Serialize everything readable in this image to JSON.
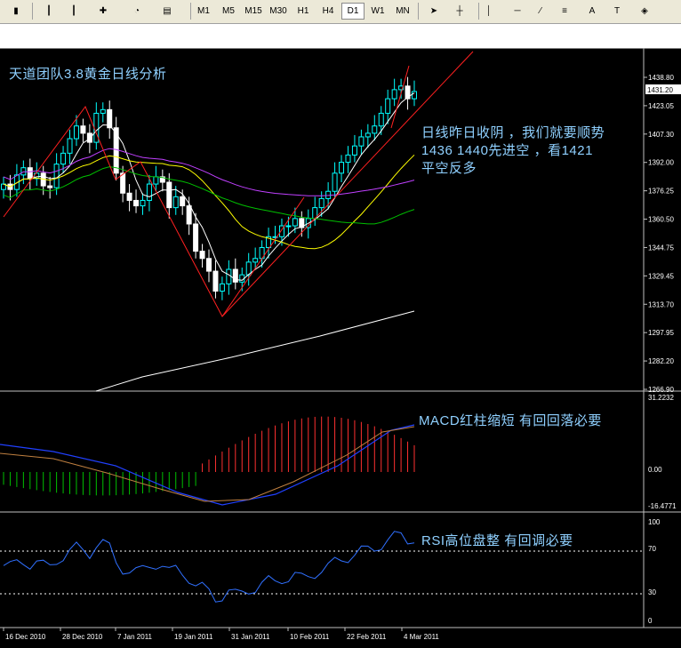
{
  "toolbar": {
    "timeframes": [
      "M1",
      "M5",
      "M15",
      "M30",
      "H1",
      "H4",
      "D1",
      "W1",
      "MN"
    ],
    "active_timeframe": "D1",
    "text_tool_label": "A",
    "text_label_tool_label": "T"
  },
  "chart": {
    "title": "天道团队3.8黄金日线分析",
    "note_lines": [
      "日线昨日收阴 ，我们就要顺势",
      "1436  1440先进空 ，看1421",
      "平空反多"
    ],
    "macd_note": "MACD红柱缩短 有回回落必要",
    "rsi_note": "RSI高位盘整 有回调必要",
    "price_scale": [
      "1438.80",
      "1423.05",
      "1407.30",
      "1392.00",
      "1376.25",
      "1360.50",
      "1344.75",
      "1329.45",
      "1313.70",
      "1297.95",
      "1282.20",
      "1266.90"
    ],
    "current_price": "1431.20",
    "macd_scale": [
      "31.2232",
      "0.00",
      "-16.4771"
    ],
    "rsi_scale": [
      "100",
      "70",
      "30",
      "0"
    ],
    "date_labels": [
      "16 Dec 2010",
      "28 Dec 2010",
      "7 Jan 2011",
      "19 Jan 2011",
      "31 Jan 2011",
      "10 Feb 2011",
      "22 Feb 2011",
      "4 Mar 2011"
    ],
    "colors": {
      "bull": "#00ff00",
      "bear": "#ffffff",
      "candle_up": "#00ffff",
      "candle_down": "#ffffff",
      "macd_pos": "#ff3030",
      "macd_neg": "#00c000",
      "trend": "#ff2020",
      "ma_short": "#ffffff",
      "ma_mid": "#ffff00",
      "ma_long": "#00c000",
      "ma_purple": "#c040ff",
      "text": "#8fd0ff",
      "rsi": "#3070ff"
    }
  },
  "chart_data": {
    "type": "candlestick",
    "xlabel": "",
    "ylabel": "",
    "ylim": [
      1266.9,
      1445
    ],
    "categories": [
      "16 Dec 2010",
      "28 Dec 2010",
      "7 Jan 2011",
      "19 Jan 2011",
      "31 Jan 2011",
      "10 Feb 2011",
      "22 Feb 2011",
      "4 Mar 2011"
    ],
    "close_series": [
      1380,
      1377,
      1385,
      1389,
      1383,
      1386,
      1379,
      1378,
      1391,
      1397,
      1405,
      1412,
      1408,
      1403,
      1419,
      1421,
      1411,
      1386,
      1375,
      1371,
      1368,
      1371,
      1380,
      1384,
      1381,
      1367,
      1373,
      1368,
      1358,
      1343,
      1339,
      1332,
      1321,
      1325,
      1333,
      1326,
      1330,
      1337,
      1339,
      1345,
      1351,
      1351,
      1357,
      1357,
      1361,
      1356,
      1361,
      1367,
      1372,
      1376,
      1386,
      1392,
      1396,
      1401,
      1406,
      1408,
      1412,
      1419,
      1427,
      1432,
      1434,
      1427,
      1431
    ],
    "macd_range": [
      -16.4771,
      31.2232
    ],
    "rsi_range": [
      0,
      100
    ],
    "rsi_levels": [
      30,
      70
    ]
  }
}
